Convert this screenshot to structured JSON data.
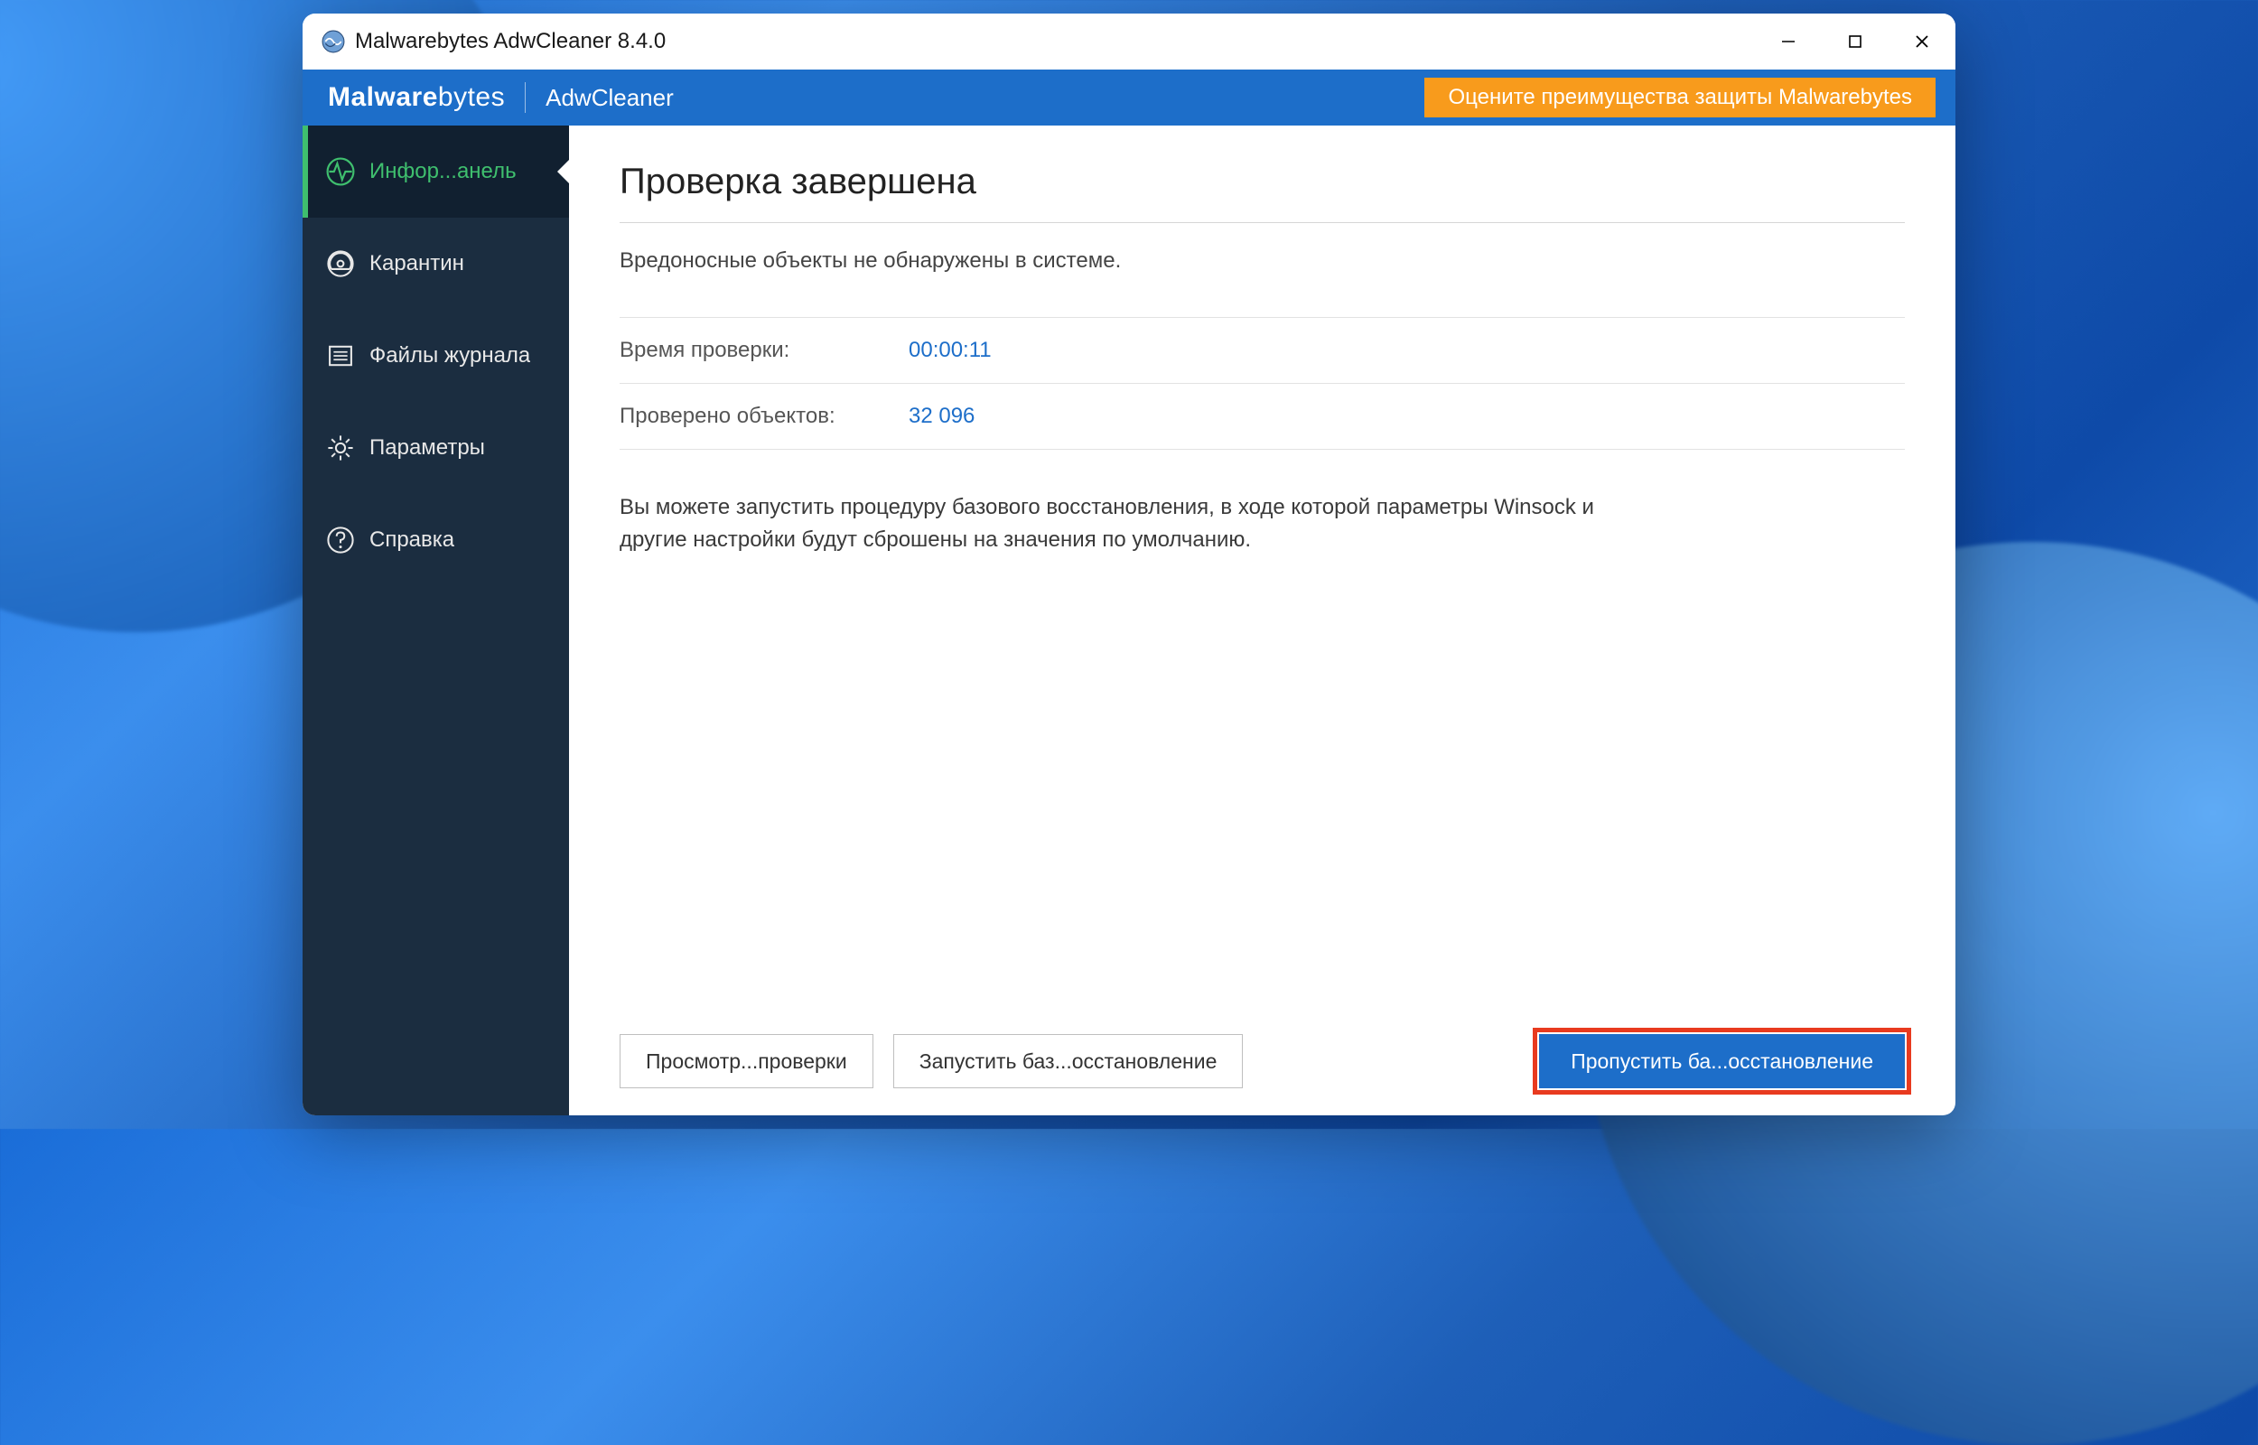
{
  "titlebar": {
    "title": "Malwarebytes AdwCleaner 8.4.0"
  },
  "header": {
    "logo_bold": "Malware",
    "logo_thin": "bytes",
    "subapp": "AdwCleaner",
    "promo": "Оцените преимущества защиты Malwarebytes"
  },
  "sidebar": {
    "items": [
      {
        "label": "Инфор...анель",
        "icon": "dashboard-icon",
        "active": true
      },
      {
        "label": "Карантин",
        "icon": "quarantine-icon"
      },
      {
        "label": "Файлы журнала",
        "icon": "log-files-icon"
      },
      {
        "label": "Параметры",
        "icon": "settings-icon"
      },
      {
        "label": "Справка",
        "icon": "help-icon"
      }
    ]
  },
  "main": {
    "title": "Проверка завершена",
    "subtitle": "Вредоносные объекты не обнаружены в системе.",
    "stats": [
      {
        "label": "Время проверки:",
        "value": "00:00:11"
      },
      {
        "label": "Проверено объектов:",
        "value": "32 096"
      }
    ],
    "description": "Вы можете запустить процедуру базового восстановления, в ходе которой параметры Winsock и другие настройки будут сброшены на значения по умолчанию."
  },
  "buttons": {
    "view_report": "Просмотр...проверки",
    "run_repair": "Запустить баз...осстановление",
    "skip_repair": "Пропустить ба...осстановление"
  }
}
